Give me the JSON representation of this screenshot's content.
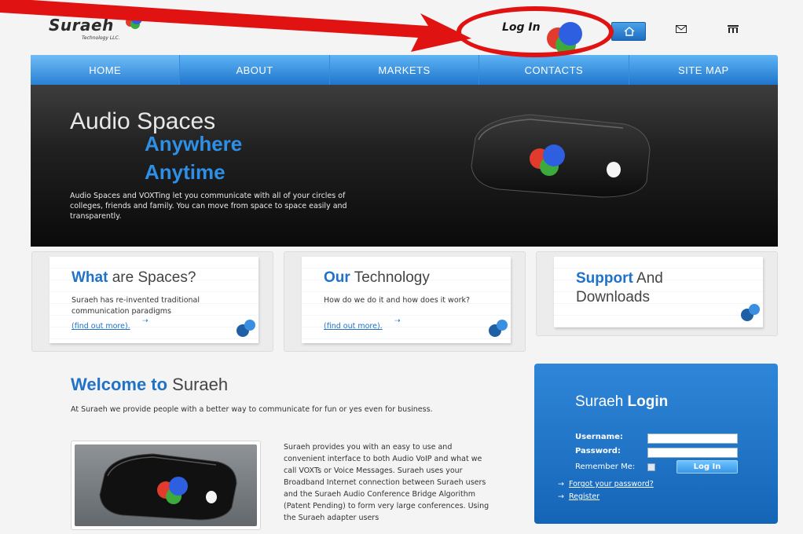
{
  "header": {
    "logo_text": "Suraeh",
    "logo_sub": "Technology LLC.",
    "login_link": "Log In"
  },
  "nav": {
    "items": [
      "HOME",
      "ABOUT",
      "MARKETS",
      "CONTACTS",
      "SITE MAP"
    ]
  },
  "hero": {
    "title1": "Audio Spaces",
    "title2": "Anywhere",
    "title3": "Anytime",
    "description": "Audio Spaces and VOXTing let you communicate with all of your circles of colleges, friends and family. You can move from space to space easily and transparently."
  },
  "features": [
    {
      "title_bold": "What",
      "title_rest": " are Spaces?",
      "text": "Suraeh has re-invented traditional communication paradigms",
      "link": "(find out more)."
    },
    {
      "title_bold": "Our",
      "title_rest": " Technology",
      "text": "How do we do it and how does it work?",
      "link": "(find out more)."
    },
    {
      "title_bold": "Support",
      "title_rest": " And Downloads"
    }
  ],
  "welcome": {
    "title_bold": "Welcome to",
    "title_rest": " Suraeh",
    "intro": "At Suraeh we provide people with a better way to communicate for fun or yes even for business.",
    "body": "Suraeh provides you with an easy to use and convenient interface to both Audio VoIP and what we call VOXTs or Voice Messages. Suraeh uses your Broadband Internet connection between Suraeh users and the Suraeh Audio Conference Bridge Algorithm (Patent Pending) to form very large conferences. Using the Suraeh adapter users"
  },
  "login": {
    "title_a": "Suraeh",
    "title_b": " Login",
    "username_label": "Username:",
    "password_label": "Password:",
    "remember_label": "Remember Me:",
    "button_label": "Log In",
    "forgot_link": "Forgot your password?",
    "register_link": "Register"
  },
  "colors": {
    "accent": "#1f72c7",
    "annotation": "#e01212"
  },
  "icons": [
    "home-icon",
    "mail-icon",
    "sitemap-icon"
  ]
}
